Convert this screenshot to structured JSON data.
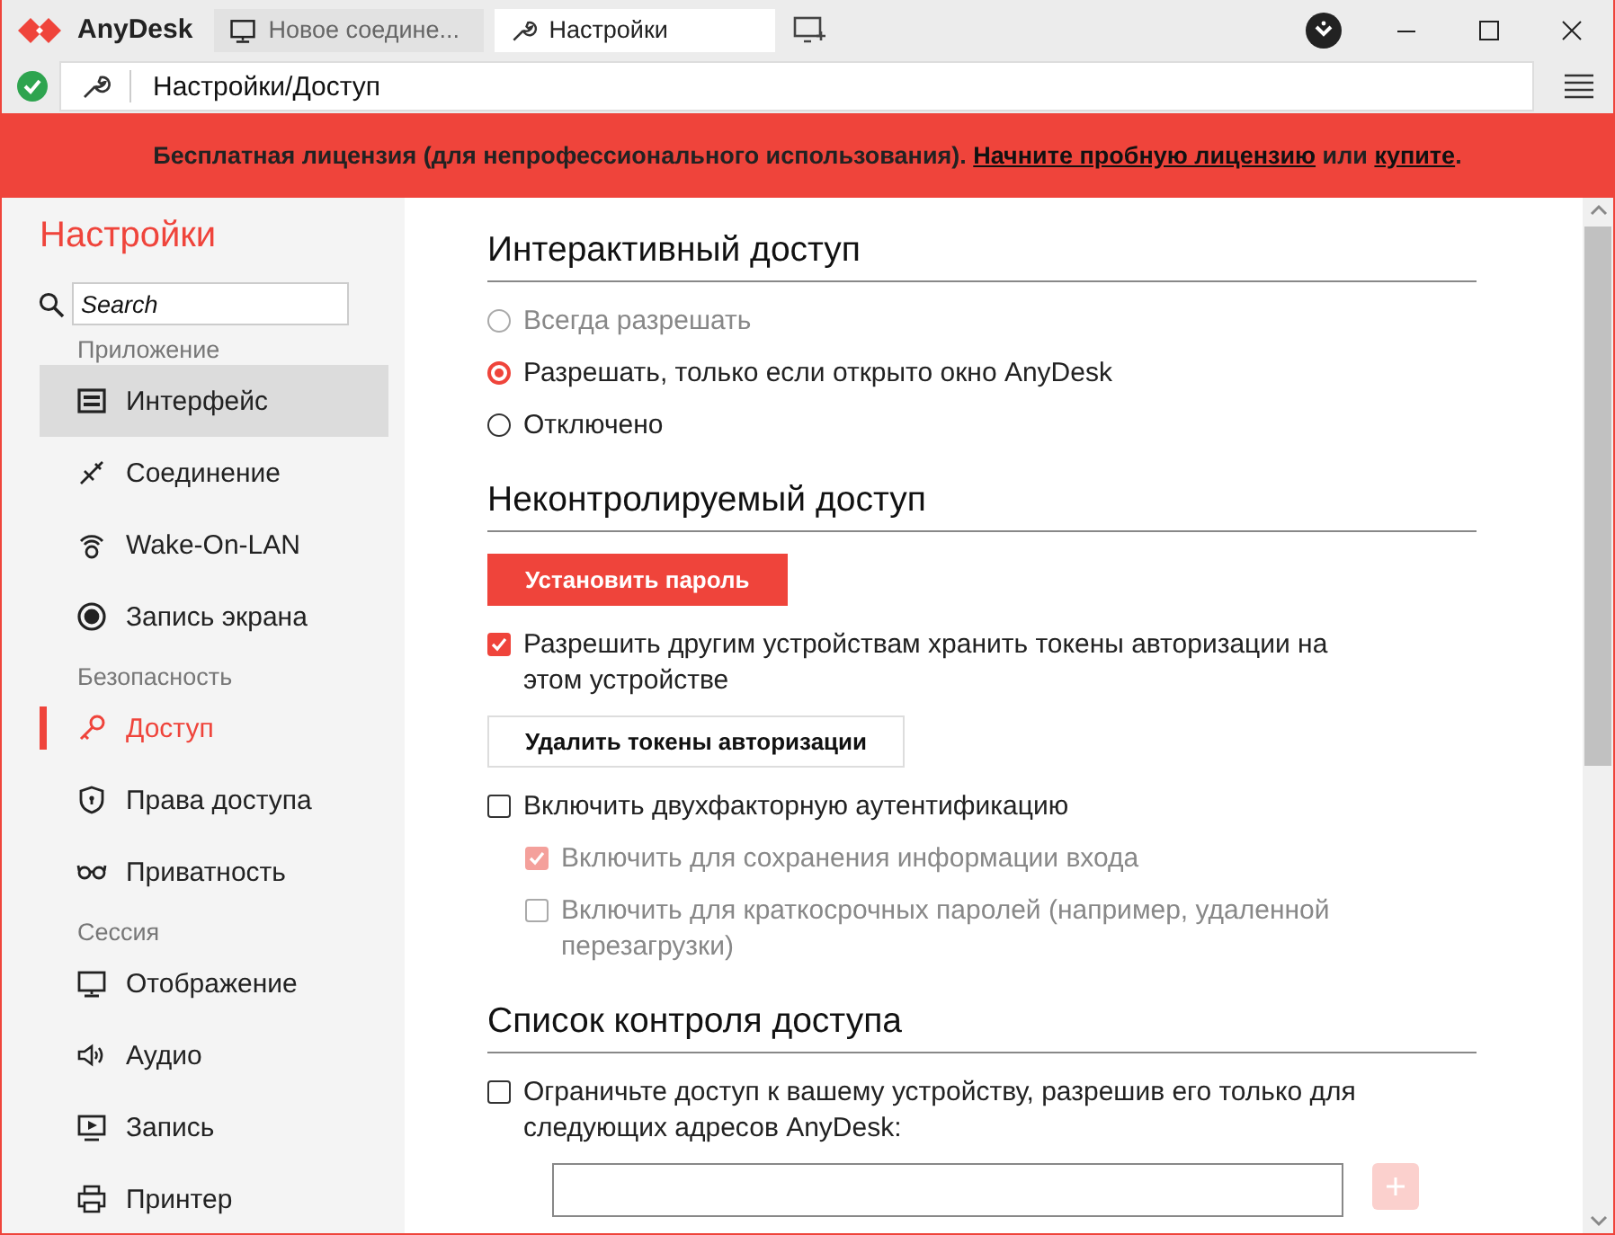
{
  "app": {
    "name": "AnyDesk"
  },
  "tabs": [
    {
      "label": "Новое соедине...",
      "kind": "monitor",
      "selected": false
    },
    {
      "label": "Настройки",
      "kind": "wrench",
      "selected": true
    }
  ],
  "address": "Настройки/Доступ",
  "banner": [
    {
      "kind": "text",
      "text": "Бесплатная лицензия (для непрофессионального использования). "
    },
    {
      "kind": "link",
      "text": "Начните пробную лицензию"
    },
    {
      "kind": "text",
      "text": " или "
    },
    {
      "kind": "link",
      "text": "купите"
    },
    {
      "kind": "text",
      "text": "."
    }
  ],
  "sidebar": {
    "title": "Настройки",
    "search": {
      "placeholder": "Search"
    },
    "groups": [
      {
        "label": "Приложение",
        "items": [
          {
            "label": "Интерфейс",
            "selected": false,
            "hovered": true
          },
          {
            "label": "Соединение",
            "selected": false,
            "hovered": false
          },
          {
            "label": "Wake-On-LAN",
            "selected": false,
            "hovered": false
          },
          {
            "label": "Запись экрана",
            "selected": false,
            "hovered": false
          }
        ]
      },
      {
        "label": "Безопасность",
        "items": [
          {
            "label": "Доступ",
            "selected": true,
            "hovered": false
          },
          {
            "label": "Права доступа",
            "selected": false,
            "hovered": false
          },
          {
            "label": "Приватность",
            "selected": false,
            "hovered": false
          }
        ]
      },
      {
        "label": "Сессия",
        "items": [
          {
            "label": "Отображение",
            "selected": false,
            "hovered": false
          },
          {
            "label": "Аудио",
            "selected": false,
            "hovered": false
          },
          {
            "label": "Запись",
            "selected": false,
            "hovered": false
          },
          {
            "label": "Принтер",
            "selected": false,
            "hovered": false
          }
        ]
      }
    ]
  },
  "sections": [
    {
      "title": "Интерактивный доступ",
      "items": [
        {
          "kind": "radio",
          "label": "Всегда разрешать",
          "selected": false,
          "disabled": true
        },
        {
          "kind": "radio",
          "label": "Разрешать, только если открыто окно AnyDesk",
          "selected": true,
          "disabled": false
        },
        {
          "kind": "radio",
          "label": "Отключено",
          "selected": false,
          "disabled": false
        }
      ]
    },
    {
      "title": "Неконтролируемый доступ",
      "items": [
        {
          "kind": "primary-button",
          "label": "Установить пароль"
        },
        {
          "kind": "checkbox",
          "label": "Разрешить другим устройствам хранить токены авторизации на этом устройстве",
          "checked": true,
          "disabled": false
        },
        {
          "kind": "button",
          "label": "Удалить токены авторизации"
        },
        {
          "kind": "checkbox",
          "label": "Включить двухфакторную аутентификацию",
          "checked": false,
          "disabled": false,
          "children": [
            {
              "kind": "checkbox",
              "label": "Включить для сохранения информации входа",
              "checked": true,
              "disabled": true
            },
            {
              "kind": "checkbox",
              "label": "Включить для краткосрочных паролей (например, удаленной перезагрузки)",
              "checked": false,
              "disabled": true
            }
          ]
        }
      ]
    },
    {
      "title": "Список контроля доступа",
      "items": [
        {
          "kind": "checkbox",
          "label": "Ограничьте доступ к вашему устройству, разрешив его только для следующих адресов AnyDesk:",
          "checked": false,
          "disabled": false
        },
        {
          "kind": "address-entry",
          "disabled": true
        }
      ]
    }
  ]
}
